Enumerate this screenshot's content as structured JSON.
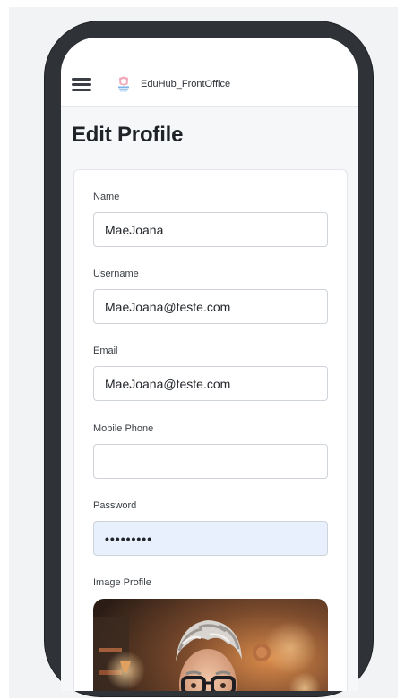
{
  "app": {
    "brand": "EduHub_FrontOffice",
    "icons": {
      "menu": "hamburger-menu-icon",
      "logo": "eduhub-logo-icon"
    }
  },
  "page": {
    "title": "Edit Profile"
  },
  "form": {
    "name": {
      "label": "Name",
      "value": "MaeJoana"
    },
    "username": {
      "label": "Username",
      "value": "MaeJoana@teste.com"
    },
    "email": {
      "label": "Email",
      "value": "MaeJoana@teste.com"
    },
    "mobile": {
      "label": "Mobile Phone",
      "value": ""
    },
    "password": {
      "label": "Password",
      "value": "123456789"
    },
    "image": {
      "label": "Image Profile"
    }
  },
  "colors": {
    "phone_frame": "#2f3237",
    "autofill_bg": "#e8f0fe",
    "title_text": "#202429"
  }
}
